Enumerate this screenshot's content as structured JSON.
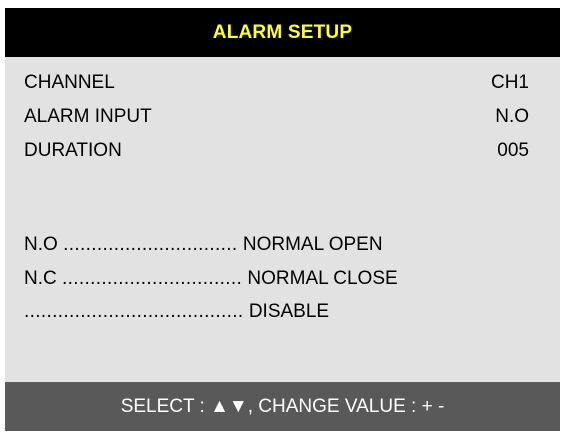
{
  "title": "ALARM SETUP",
  "settings": [
    {
      "label": "CHANNEL",
      "value": "CH1"
    },
    {
      "label": "ALARM INPUT",
      "value": "N.O"
    },
    {
      "label": "DURATION",
      "value": "005"
    }
  ],
  "legend": [
    {
      "key": "N.O",
      "leader": "...............................",
      "meaning": "NORMAL OPEN"
    },
    {
      "key": "N.C",
      "leader": "................................",
      "meaning": "NORMAL CLOSE"
    },
    {
      "key": "",
      "leader": ".......................................",
      "meaning": "DISABLE"
    }
  ],
  "footer": "SELECT : ▲▼, CHANGE VALUE : + -",
  "colors": {
    "title_bar": "#000000",
    "title_text": "#ffff33",
    "panel": "#e2e2e2",
    "footer_bar": "#595959",
    "footer_text": "#ffffff"
  }
}
